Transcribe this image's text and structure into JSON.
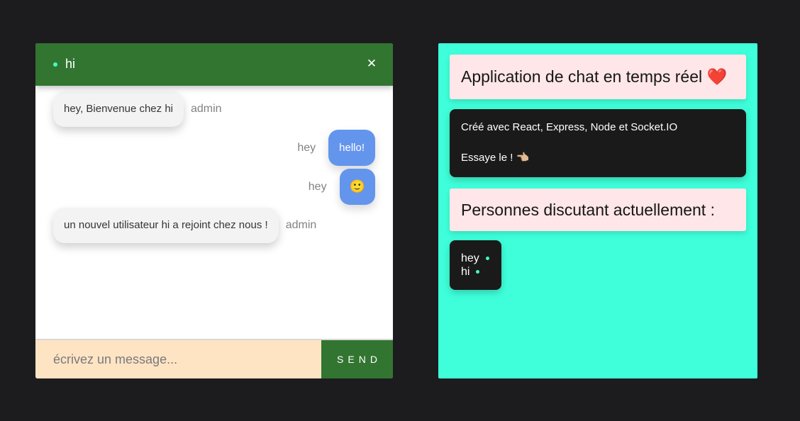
{
  "chat": {
    "room_name": "hi",
    "close_label": "✕",
    "messages": [
      {
        "text": "hey, Bienvenue chez hi",
        "sender": "admin",
        "side": "left"
      },
      {
        "text": "hello!",
        "sender": "hey",
        "side": "right"
      },
      {
        "text": "🙂",
        "sender": "hey",
        "side": "right"
      },
      {
        "text": "un nouvel utilisateur hi a rejoint chez nous !",
        "sender": "admin",
        "side": "left"
      }
    ],
    "input": {
      "placeholder": "écrivez un message...",
      "value": ""
    },
    "send_label": "SEND"
  },
  "info": {
    "title": "Application de chat en temps réel ❤️",
    "tech_text": "Créé avec React, Express, Node et Socket.IO",
    "try_text": "Essaye le ! 👈🏼",
    "people_title": "Personnes discutant actuellement :",
    "users": [
      "hey",
      "hi"
    ]
  },
  "colors": {
    "background": "#1c1c1f",
    "header_green": "#317531",
    "online_dot": "#3fffbe",
    "own_bubble": "#6495ed",
    "other_bubble": "#f3f3f3",
    "input_bg": "#ffe4c4",
    "info_panel": "#3effda",
    "info_card": "#ffe6e8",
    "dark_card": "#1a1a1a"
  }
}
